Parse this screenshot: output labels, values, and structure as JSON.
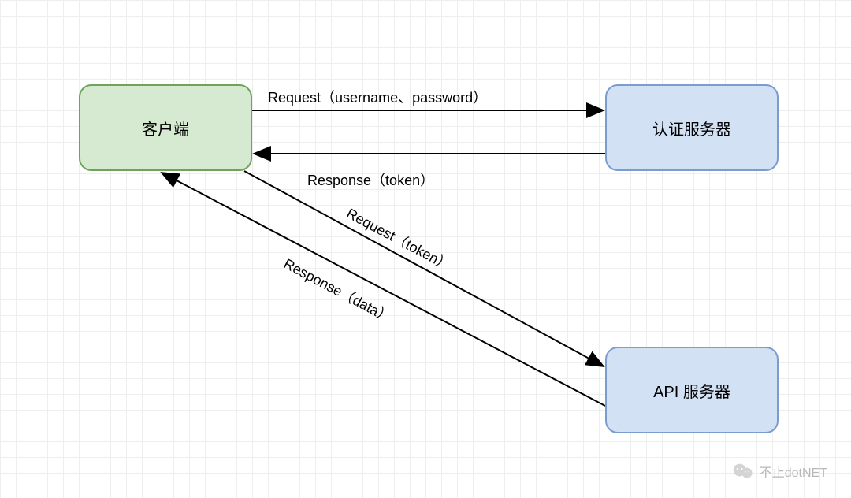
{
  "nodes": {
    "client": {
      "label": "客户端"
    },
    "auth": {
      "label": "认证服务器"
    },
    "api": {
      "label": "API 服务器"
    }
  },
  "edges": {
    "req_auth": {
      "label": "Request（username、password）"
    },
    "resp_auth": {
      "label": "Response（token）"
    },
    "req_api": {
      "label": "Request（token）"
    },
    "resp_api": {
      "label": "Response（data）"
    }
  },
  "watermark": {
    "text": "不止dotNET"
  }
}
